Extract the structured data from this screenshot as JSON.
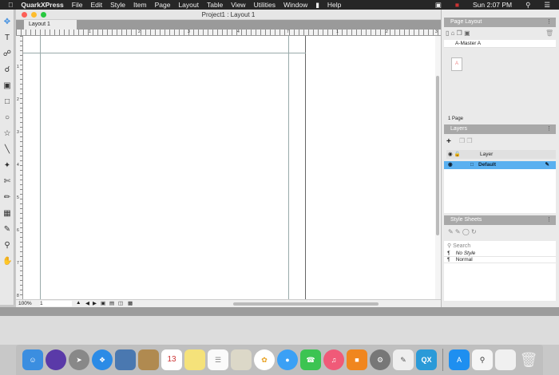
{
  "menubar": {
    "app": "QuarkXPress",
    "items": [
      "File",
      "Edit",
      "Style",
      "Item",
      "Page",
      "Layout",
      "Table",
      "View",
      "Utilities",
      "Window",
      "Help"
    ],
    "clock": "Sun 2:07 PM"
  },
  "window": {
    "title": "Project1 : Layout 1",
    "tab": "Layout 1"
  },
  "ruler": {
    "h": [
      "1",
      "2",
      "3",
      "4",
      "5",
      "6",
      "7",
      "8",
      "1",
      "2",
      "3"
    ],
    "v": [
      "1",
      "2",
      "3",
      "4",
      "5",
      "6",
      "7",
      "8"
    ]
  },
  "status": {
    "zoom": "100%",
    "page": "1"
  },
  "page_layout": {
    "title": "Page Layout",
    "master": "A-Master A",
    "thumb": "A",
    "count": "1 Page"
  },
  "layers": {
    "title": "Layers",
    "header": "Layer",
    "item": "Default"
  },
  "style_sheets": {
    "title": "Style Sheets",
    "search_placeholder": "Search",
    "items": [
      "No Style",
      "Normal"
    ]
  },
  "dock": {
    "calendar_day": "13"
  },
  "colors": {
    "accent": "#5ab0f0",
    "menubar": "#262626"
  }
}
